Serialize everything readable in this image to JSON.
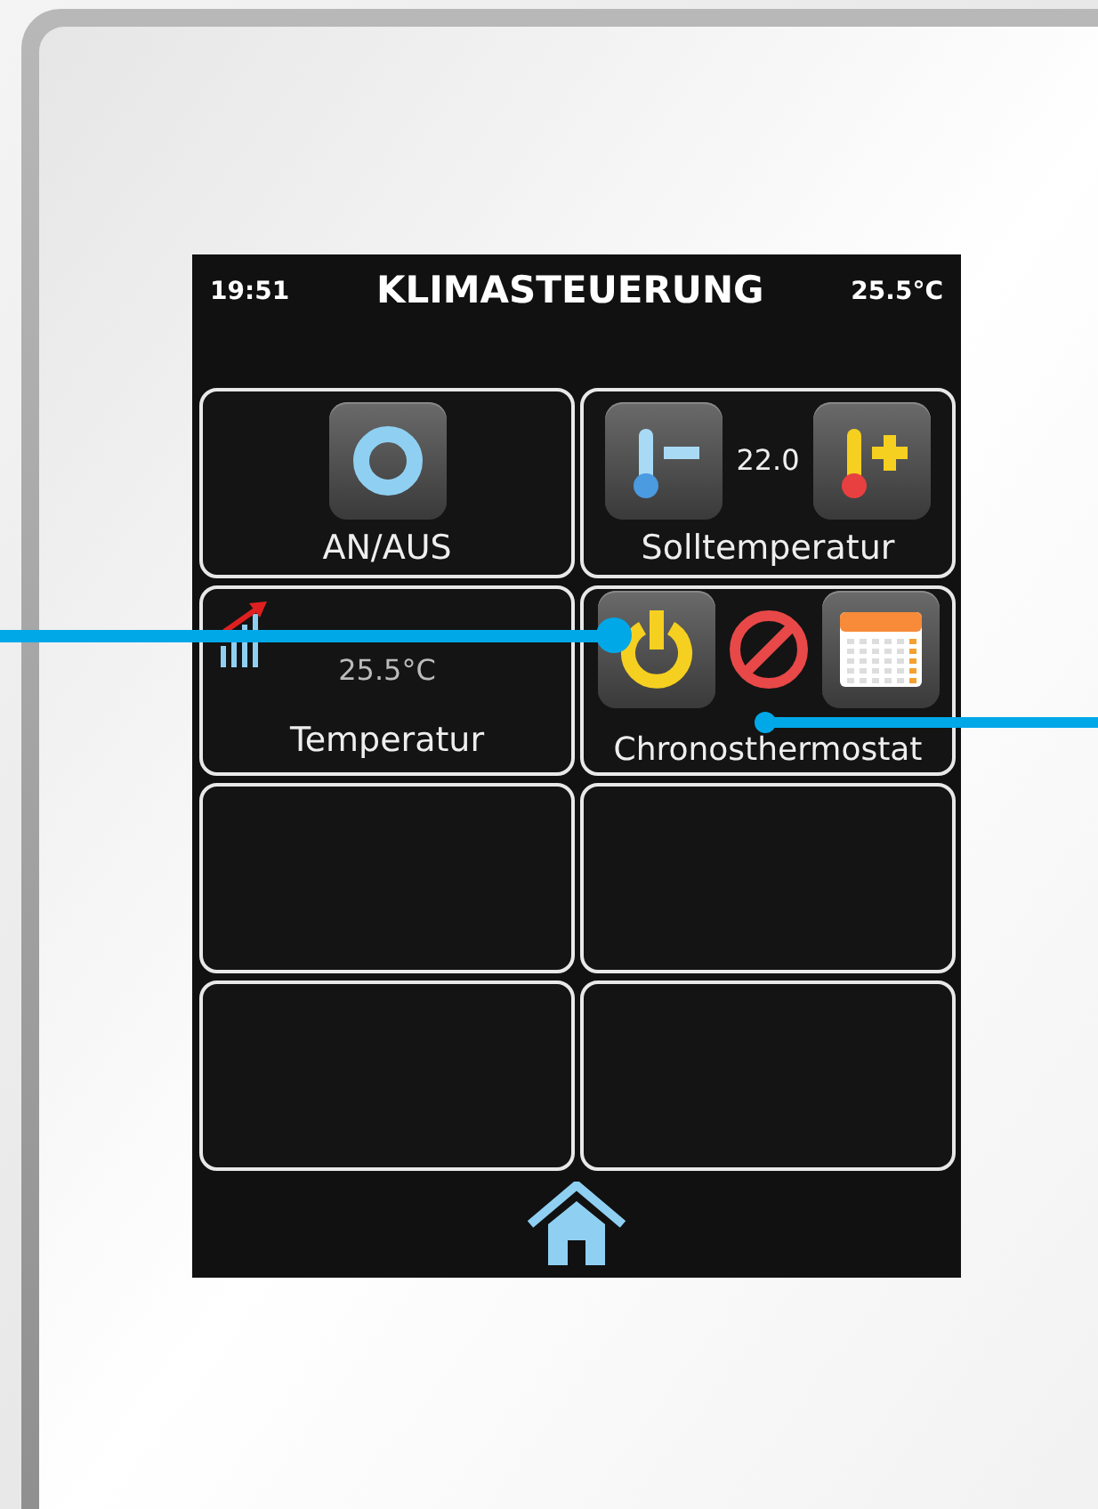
{
  "header": {
    "time": "19:51",
    "title": "KLIMASTEUERUNG",
    "temperature": "25.5°C"
  },
  "tiles": [
    {
      "kind": "power",
      "label": "AN/AUS"
    },
    {
      "kind": "setpoint",
      "label": "Solltemperatur",
      "value": "22.0"
    },
    {
      "kind": "temperature",
      "label": "Temperatur",
      "value": "25.5°C"
    },
    {
      "kind": "chrono",
      "label": "Chronosthermostat"
    },
    {
      "kind": "empty"
    },
    {
      "kind": "empty"
    },
    {
      "kind": "empty"
    },
    {
      "kind": "empty"
    }
  ]
}
